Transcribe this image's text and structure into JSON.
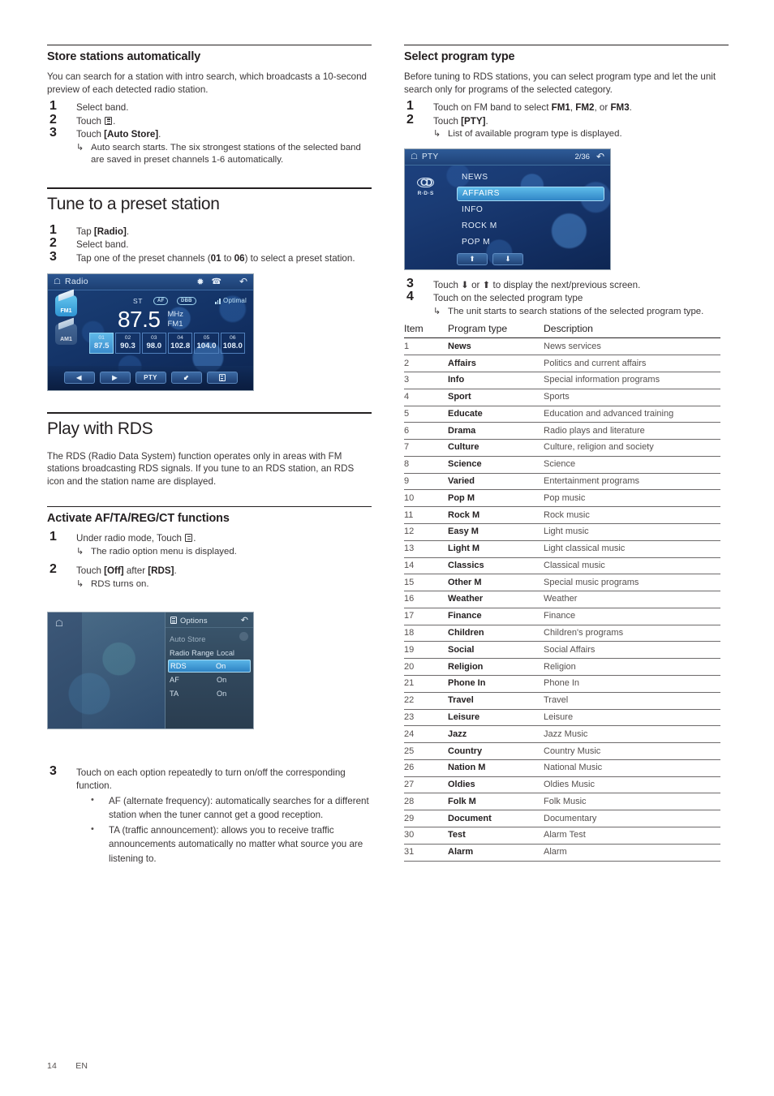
{
  "left_column": {
    "section_store": {
      "heading": "Store stations automatically",
      "intro": "You can search for a station with intro search, which broadcasts a 10-second preview of each detected radio station.",
      "steps": [
        {
          "num": "1",
          "text": "Select band."
        },
        {
          "num": "2",
          "text_before": "Touch ",
          "text_after": "."
        },
        {
          "num": "3",
          "text_before": "Touch ",
          "bold": "[Auto Store]",
          "text_after": ".",
          "sub": "Auto search starts. The six strongest stations of the selected band are saved in preset channels 1-6 automatically."
        }
      ]
    },
    "section_tune": {
      "heading": "Tune to a preset station",
      "steps": [
        {
          "num": "1",
          "text_before": "Tap ",
          "bold": "[Radio]",
          "text_after": "."
        },
        {
          "num": "2",
          "text": "Select band."
        },
        {
          "num": "3",
          "text_a": "Tap one of the preset channels (",
          "bold_a": "01",
          "text_b": " to ",
          "bold_b": "06",
          "text_c": ") to select a preset station."
        }
      ]
    },
    "section_rds": {
      "heading": "Play with RDS",
      "body": "The RDS (Radio Data System) function operates only in areas with FM stations broadcasting RDS signals. If you tune to an RDS station, an RDS icon and the station name are displayed."
    },
    "section_activate": {
      "heading": "Activate AF/TA/REG/CT functions",
      "steps": [
        {
          "num": "1",
          "text_before": "Under radio mode, Touch ",
          "text_after": ".",
          "sub": "The radio option menu is displayed."
        },
        {
          "num": "2",
          "text_before": "Touch ",
          "bold_a": "[Off]",
          "mid": " after ",
          "bold_b": "[RDS]",
          "text_after": ".",
          "sub": "RDS turns on."
        },
        {
          "num": "3",
          "text": "Touch on each option repeatedly to turn on/off the corresponding function."
        }
      ],
      "bullets": [
        "AF (alternate frequency): automatically searches for a different station when the tuner cannot get a good reception.",
        "TA (traffic announcement): allows you to receive traffic announcements automatically no matter what source you are listening to."
      ]
    }
  },
  "right_column": {
    "section_pty": {
      "heading": "Select program type",
      "intro": "Before tuning to RDS stations, you can select program type and let the unit search only for programs of the selected category.",
      "steps": [
        {
          "num": "1",
          "text_a": "Touch on FM band to select ",
          "bold_a": "FM1",
          "text_b": ", ",
          "bold_b": "FM2",
          "text_c": ", or ",
          "bold_c": "FM3",
          "text_d": "."
        },
        {
          "num": "2",
          "text_before": "Touch ",
          "bold": "[PTY]",
          "text_after": ".",
          "sub": "List of available program type is displayed."
        },
        {
          "num": "3",
          "text": "Touch ⬇ or ⬆ to display the next/previous screen."
        },
        {
          "num": "4",
          "text": "Touch on the selected program type",
          "sub": "The unit starts to search stations of the selected program type."
        }
      ]
    },
    "table": {
      "headers": [
        "Item",
        "Program type",
        "Description"
      ],
      "rows": [
        [
          "1",
          "News",
          "News services"
        ],
        [
          "2",
          "Affairs",
          "Politics and current affairs"
        ],
        [
          "3",
          "Info",
          "Special information programs"
        ],
        [
          "4",
          "Sport",
          "Sports"
        ],
        [
          "5",
          "Educate",
          "Education and advanced training"
        ],
        [
          "6",
          "Drama",
          "Radio plays and literature"
        ],
        [
          "7",
          "Culture",
          "Culture, religion and society"
        ],
        [
          "8",
          "Science",
          "Science"
        ],
        [
          "9",
          "Varied",
          "Entertainment programs"
        ],
        [
          "10",
          "Pop M",
          "Pop music"
        ],
        [
          "11",
          "Rock M",
          "Rock music"
        ],
        [
          "12",
          "Easy M",
          "Light music"
        ],
        [
          "13",
          "Light M",
          "Light classical music"
        ],
        [
          "14",
          "Classics",
          "Classical music"
        ],
        [
          "15",
          "Other M",
          "Special music programs"
        ],
        [
          "16",
          "Weather",
          "Weather"
        ],
        [
          "17",
          "Finance",
          "Finance"
        ],
        [
          "18",
          "Children",
          "Children's programs"
        ],
        [
          "19",
          "Social",
          "Social Affairs"
        ],
        [
          "20",
          "Religion",
          "Religion"
        ],
        [
          "21",
          "Phone In",
          "Phone In"
        ],
        [
          "22",
          "Travel",
          "Travel"
        ],
        [
          "23",
          "Leisure",
          "Leisure"
        ],
        [
          "24",
          "Jazz",
          "Jazz Music"
        ],
        [
          "25",
          "Country",
          "Country Music"
        ],
        [
          "26",
          "Nation M",
          "National Music"
        ],
        [
          "27",
          "Oldies",
          "Oldies Music"
        ],
        [
          "28",
          "Folk M",
          "Folk Music"
        ],
        [
          "29",
          "Document",
          "Documentary"
        ],
        [
          "30",
          "Test",
          "Alarm Test"
        ],
        [
          "31",
          "Alarm",
          "Alarm"
        ]
      ]
    }
  },
  "radio_screen": {
    "title": "Radio",
    "status": {
      "stereo": "ST",
      "pill1": "AF",
      "pill2": "DBB",
      "signal": "Optimal"
    },
    "bands": [
      {
        "label": "FM1",
        "active": true
      },
      {
        "label": "AM1",
        "active": false
      }
    ],
    "frequency": "87.5",
    "unit": "MHz",
    "band": "FM1",
    "presets": [
      {
        "no": "01",
        "freq": "87.5",
        "selected": true
      },
      {
        "no": "02",
        "freq": "90.3",
        "selected": false
      },
      {
        "no": "03",
        "freq": "98.0",
        "selected": false
      },
      {
        "no": "04",
        "freq": "102.8",
        "selected": false
      },
      {
        "no": "05",
        "freq": "104.0",
        "selected": false
      },
      {
        "no": "06",
        "freq": "108.0",
        "selected": false
      }
    ],
    "buttons": [
      "◀",
      "▶",
      "PTY",
      "⬋",
      "menu"
    ]
  },
  "options_screen": {
    "title": "Options",
    "rows": [
      {
        "key": "Auto Store",
        "value": "",
        "state": "dim"
      },
      {
        "key": "Radio Range",
        "value": "Local",
        "state": "normal"
      },
      {
        "key": "RDS",
        "value": "On",
        "state": "selected"
      },
      {
        "key": "AF",
        "value": "On",
        "state": "normal"
      },
      {
        "key": "TA",
        "value": "On",
        "state": "normal"
      }
    ]
  },
  "pty_screen": {
    "title": "PTY",
    "counter": "2/36",
    "logo_top": "CD",
    "logo_bottom": "R·D·S",
    "items": [
      {
        "label": "NEWS",
        "selected": false
      },
      {
        "label": "AFFAIRS",
        "selected": true
      },
      {
        "label": "INFO",
        "selected": false
      },
      {
        "label": "ROCK M",
        "selected": false
      },
      {
        "label": "POP M",
        "selected": false
      }
    ],
    "buttons": [
      "⬆",
      "⬇"
    ]
  },
  "footer": {
    "page": "14",
    "lang": "EN"
  },
  "colors": {
    "text": "#231f20",
    "body_text": "#3a3637",
    "table_text": "#55504f",
    "screen_accent": "#4aa3dd",
    "screen_bg_dark": "#0d2550"
  }
}
